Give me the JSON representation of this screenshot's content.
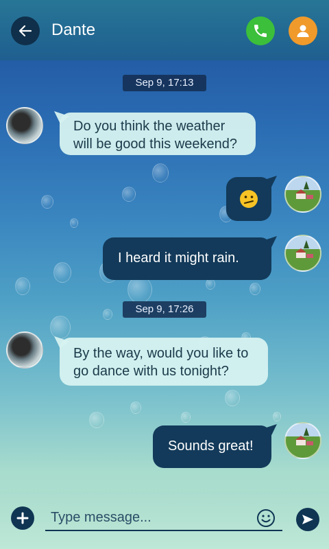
{
  "header": {
    "contact_name": "Dante"
  },
  "messages": [
    {
      "type": "timestamp",
      "text": "Sep 9, 17:13"
    },
    {
      "type": "incoming",
      "lines": [
        "Do you think the weather",
        "will be good this weekend?"
      ]
    },
    {
      "type": "outgoing",
      "emoji": "confused-face-emoji"
    },
    {
      "type": "outgoing",
      "text": "I heard it might rain."
    },
    {
      "type": "timestamp",
      "text": "Sep 9, 17:26"
    },
    {
      "type": "incoming",
      "lines": [
        "By the way, would you like to",
        "go dance with us tonight?"
      ]
    },
    {
      "type": "outgoing",
      "text": "Sounds great!"
    }
  ],
  "composer": {
    "placeholder": "Type message..."
  },
  "colors": {
    "call": "#3cbf3a",
    "contact": "#f09a2b",
    "outgoing_bubble": "#133a5a",
    "incoming_bubble": "#d6f2f0"
  }
}
